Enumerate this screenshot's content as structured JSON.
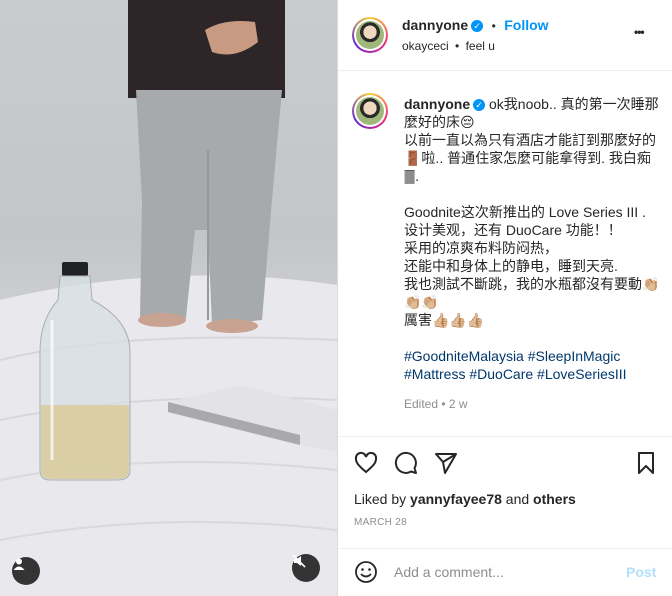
{
  "post": {
    "author": "dannyone",
    "follow_label": "Follow",
    "dot": "•",
    "audio_artist": "okayceci",
    "audio_track": "feel u",
    "more_label": "•••"
  },
  "caption": {
    "author": "dannyone",
    "line1": "ok我noob.. 真的第一次睡那麼好的床😔",
    "line2": "以前一直以為只有酒店才能訂到那麼好的🚪啦.. 普通住家怎麼可能拿得到. 我白痴🀫.",
    "para2": [
      "Goodnite这次新推出的 Love Series III .",
      "设计美观，还有 DuoCare 功能！！",
      "采用的凉爽布料防闷热，",
      "还能中和身体上的静电，睡到天亮.",
      "我也測試不斷跳，我的水瓶都沒有要動👏🏼👏🏼👏🏼",
      "厲害👍🏼👍🏼👍🏼"
    ],
    "hashtags_line1": "#GoodniteMalaysia #SleepInMagic",
    "hashtags_line2": "#Mattress #DuoCare #LoveSeriesIII",
    "edited": "Edited",
    "age": "2 w"
  },
  "engagement": {
    "liked_prefix": "Liked by",
    "liked_user": "yannyfayee78",
    "liked_and": "and",
    "liked_others": "others",
    "date": "MARCH 28"
  },
  "comment": {
    "placeholder": "Add a comment...",
    "post_label": "Post"
  },
  "colors": {
    "accent": "#0095f6",
    "link": "#00376b",
    "muted": "#8e8e8e",
    "post_disabled": "#b2dffc"
  }
}
